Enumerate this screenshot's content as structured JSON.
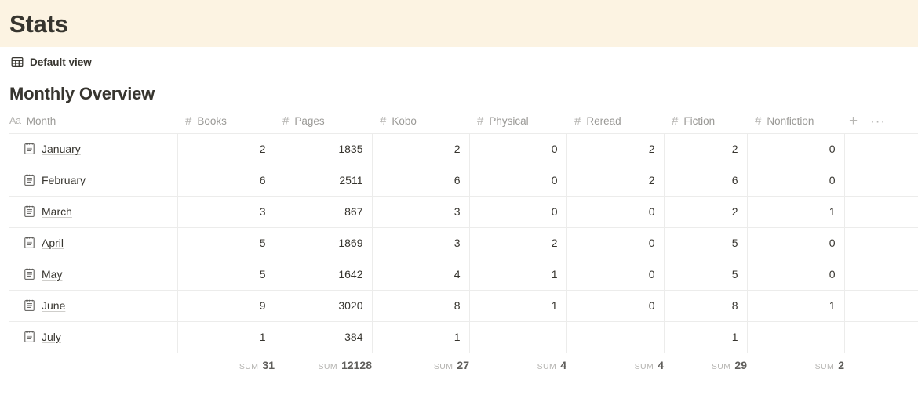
{
  "page": {
    "title": "Stats",
    "title_band_color": "#fcf3e2"
  },
  "view_bar": {
    "icon": "table-grid-icon",
    "label": "Default view"
  },
  "section": {
    "heading": "Monthly Overview"
  },
  "table": {
    "columns": [
      {
        "label": "Month",
        "type_icon": "Aa",
        "align": "left"
      },
      {
        "label": "Books",
        "type_icon": "#",
        "align": "right"
      },
      {
        "label": "Pages",
        "type_icon": "#",
        "align": "right"
      },
      {
        "label": "Kobo",
        "type_icon": "#",
        "align": "right"
      },
      {
        "label": "Physical",
        "type_icon": "#",
        "align": "right"
      },
      {
        "label": "Reread",
        "type_icon": "#",
        "align": "right"
      },
      {
        "label": "Fiction",
        "type_icon": "#",
        "align": "right"
      },
      {
        "label": "Nonfiction",
        "type_icon": "#",
        "align": "right"
      }
    ],
    "tools": {
      "add_label": "+",
      "more_label": "···"
    },
    "rows": [
      {
        "month": "January",
        "books": "2",
        "pages": "1835",
        "kobo": "2",
        "physical": "0",
        "reread": "2",
        "fiction": "2",
        "nonfiction": "0"
      },
      {
        "month": "February",
        "books": "6",
        "pages": "2511",
        "kobo": "6",
        "physical": "0",
        "reread": "2",
        "fiction": "6",
        "nonfiction": "0"
      },
      {
        "month": "March",
        "books": "3",
        "pages": "867",
        "kobo": "3",
        "physical": "0",
        "reread": "0",
        "fiction": "2",
        "nonfiction": "1"
      },
      {
        "month": "April",
        "books": "5",
        "pages": "1869",
        "kobo": "3",
        "physical": "2",
        "reread": "0",
        "fiction": "5",
        "nonfiction": "0"
      },
      {
        "month": "May",
        "books": "5",
        "pages": "1642",
        "kobo": "4",
        "physical": "1",
        "reread": "0",
        "fiction": "5",
        "nonfiction": "0"
      },
      {
        "month": "June",
        "books": "9",
        "pages": "3020",
        "kobo": "8",
        "physical": "1",
        "reread": "0",
        "fiction": "8",
        "nonfiction": "1"
      },
      {
        "month": "July",
        "books": "1",
        "pages": "384",
        "kobo": "1",
        "physical": "",
        "reread": "",
        "fiction": "1",
        "nonfiction": ""
      }
    ],
    "footer": {
      "sum_label": "SUM",
      "sums": {
        "books": "31",
        "pages": "12128",
        "kobo": "27",
        "physical": "4",
        "reread": "4",
        "fiction": "29",
        "nonfiction": "2"
      }
    }
  }
}
